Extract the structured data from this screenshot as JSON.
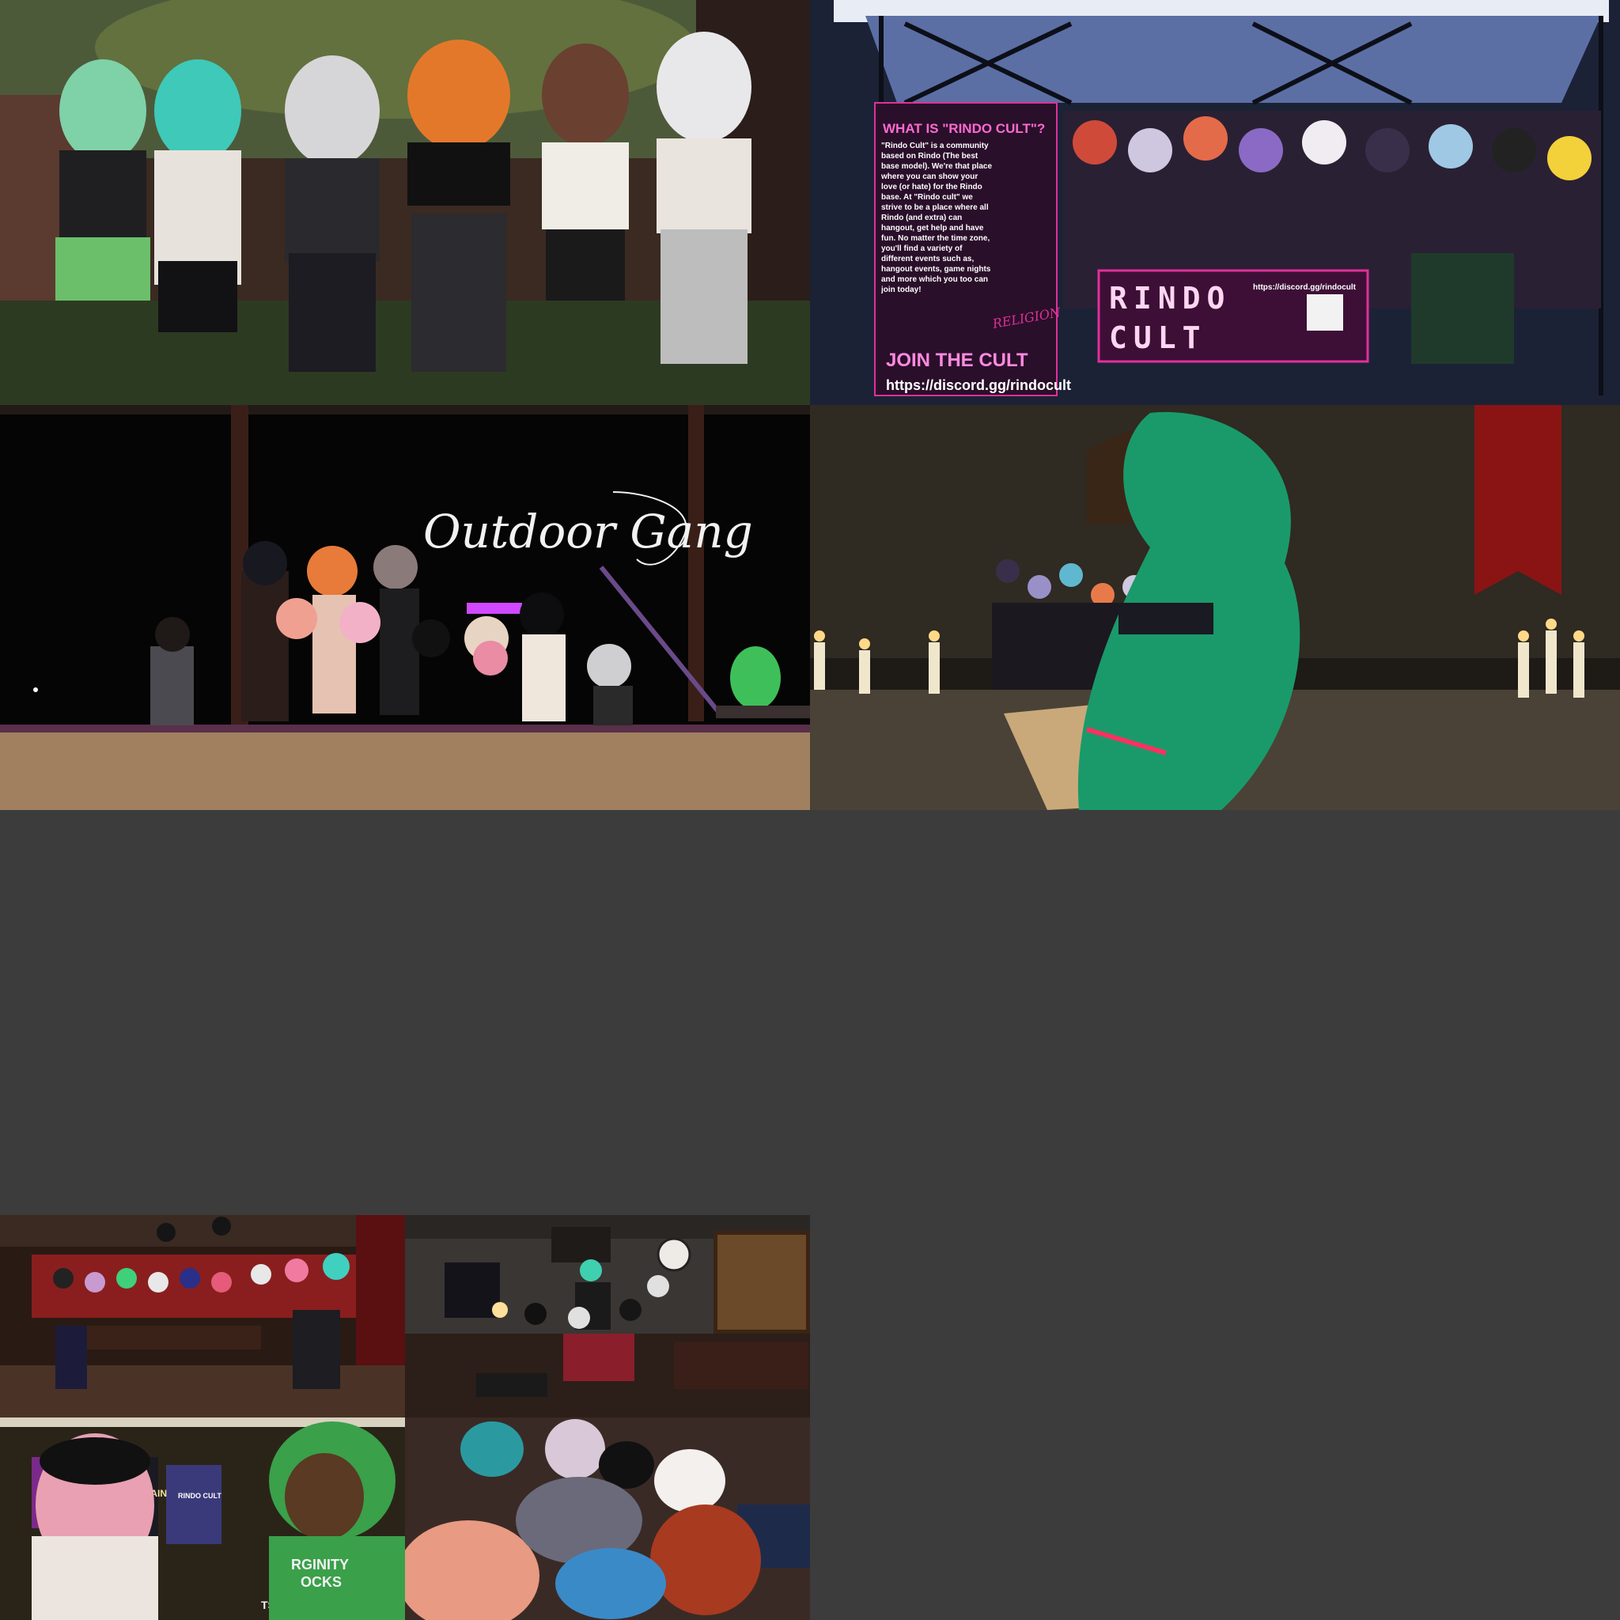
{
  "tiles": {
    "group_photo_backyard": {},
    "rindo_booth": {
      "banner_heading": "WHAT IS \"RINDO CULT\"?",
      "banner_body": "\"Rindo Cult\" is a community based on Rindo (The best base model). We're that place where you can show your love (or hate) for the Rindo base. At \"Rindo cult\" we strive to be a place where all Rindo (and extra) can hangout, get help and have fun. No matter the time zone, you'll find a variety of different events such as, hangout events, game nights and more which you too can join today!",
      "join_text": "JOIN THE CULT",
      "religion_text": "RELIGION",
      "banner_url": "https://discord.gg/rindocult",
      "table_line1": "RINDO",
      "table_line2": "CULT",
      "table_url": "https://discord.gg/rindocult"
    },
    "outdoor_gang": {
      "chalk_text": "Outdoor Gang"
    },
    "candle_hall": {},
    "booth_lounge": {},
    "living_room": {},
    "poster_room": {
      "shirt_text_1": "RGINITY",
      "shirt_text_2": "OCKS",
      "poster_text_1": "BARGAIN",
      "poster_text_2": "RINDO CULT",
      "poster_text_3": "TSUCH"
    },
    "cuddle_pile": {}
  },
  "colors": {
    "page_background": "#3c3c3c",
    "rindo_magenta": "#e0309a",
    "chalk": "#f2f2f2"
  }
}
